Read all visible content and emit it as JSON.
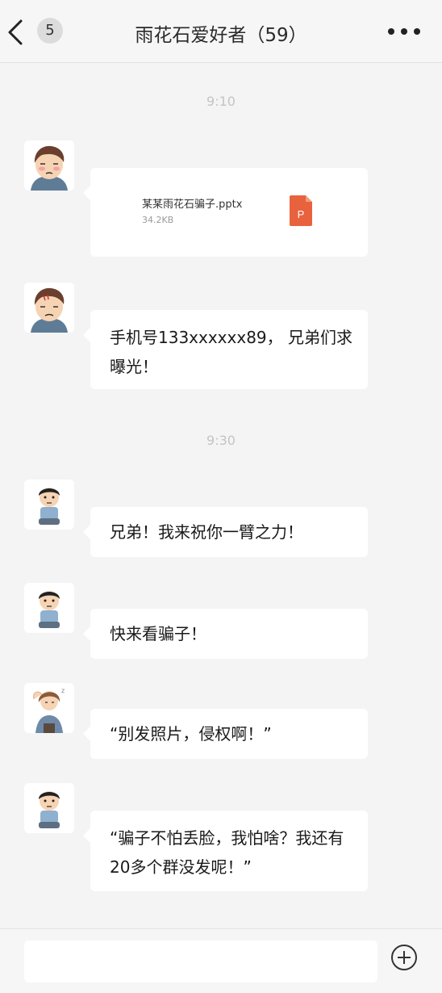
{
  "header": {
    "back_icon": "chevron-left-icon",
    "unread_count": "5",
    "title": "雨花石爱好者（59）",
    "more_icon": "ellipsis-icon"
  },
  "messages": [
    {
      "type": "time",
      "text": "9:10"
    },
    {
      "type": "file",
      "avatar": "avatar-man-sick",
      "file_name": "某某雨花石骗子.pptx",
      "file_size": "34.2KB",
      "file_icon": "ppt-file-icon",
      "icon_label": "P",
      "icon_color": "#e8623d"
    },
    {
      "type": "text",
      "avatar": "avatar-man-sick",
      "text": "手机号133xxxxxx89，  兄弟们求曝光！"
    },
    {
      "type": "time",
      "text": "9:30"
    },
    {
      "type": "text",
      "avatar": "avatar-boy-sitting",
      "text": "兄弟！我来祝你一臂之力！"
    },
    {
      "type": "text",
      "avatar": "avatar-boy-sitting",
      "text": "快来看骗子！"
    },
    {
      "type": "text",
      "avatar": "avatar-woman-headache",
      "text": "“别发照片，侵权啊！”"
    },
    {
      "type": "text",
      "avatar": "avatar-boy-sitting",
      "text": "“骗子不怕丢脸，我怕啥？我还有20多个群没发呢！”"
    }
  ],
  "input_bar": {
    "placeholder": "",
    "plus_icon": "add-circle-icon"
  },
  "colors": {
    "background": "#f4f4f4",
    "bubble": "#ffffff",
    "ppt_orange": "#e8623d",
    "time_text": "#c4c4c4"
  }
}
